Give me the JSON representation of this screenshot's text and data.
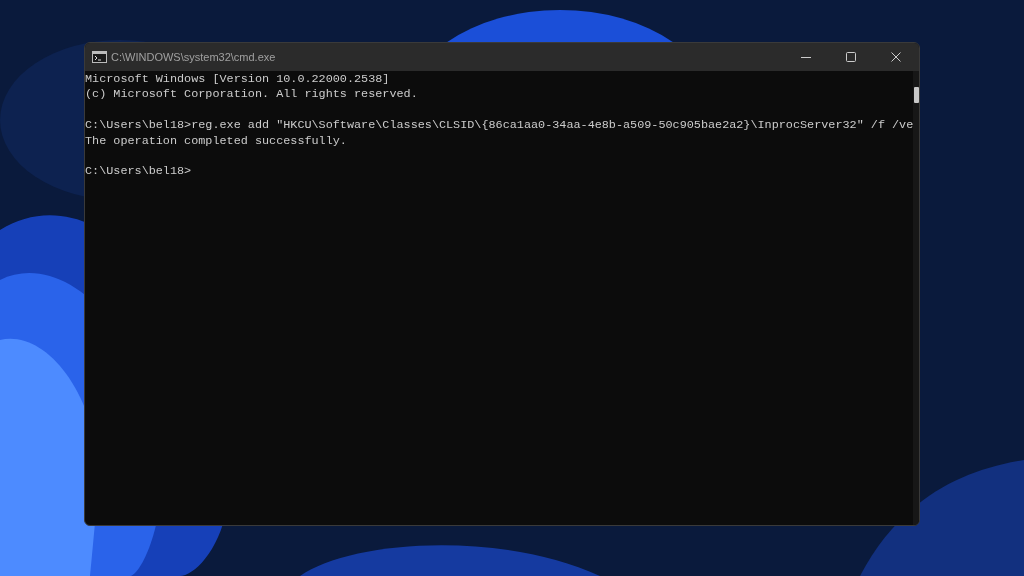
{
  "window": {
    "title": "C:\\WINDOWS\\system32\\cmd.exe"
  },
  "console": {
    "blocks": [
      [
        "Microsoft Windows [Version 10.0.22000.2538]",
        "(c) Microsoft Corporation. All rights reserved."
      ],
      [
        "C:\\Users\\bel18>reg.exe add \"HKCU\\Software\\Classes\\CLSID\\{86ca1aa0-34aa-4e8b-a509-50c905bae2a2}\\InprocServer32\" /f /ve",
        "The operation completed successfully."
      ],
      [
        "C:\\Users\\bel18>"
      ]
    ]
  }
}
